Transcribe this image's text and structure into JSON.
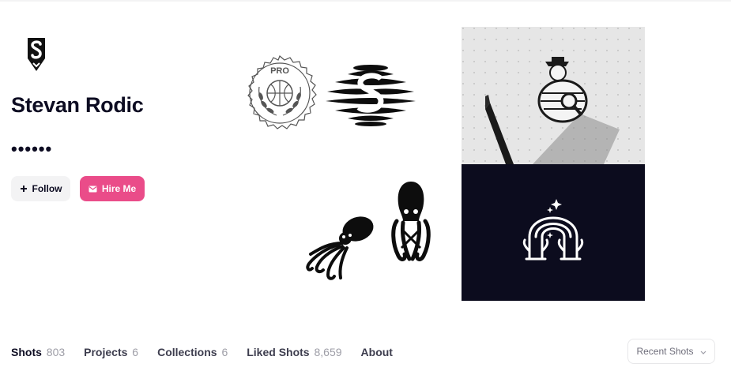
{
  "profile": {
    "name": "Stevan Rodic",
    "bio_dots": "••••••"
  },
  "actions": {
    "follow_label": "Follow",
    "hire_label": "Hire Me"
  },
  "shots": {
    "pro_badge_text": "PRO"
  },
  "tabs": [
    {
      "label": "Shots",
      "count": "803"
    },
    {
      "label": "Projects",
      "count": "6"
    },
    {
      "label": "Collections",
      "count": "6"
    },
    {
      "label": "Liked Shots",
      "count": "8,659"
    },
    {
      "label": "About",
      "count": ""
    }
  ],
  "sort": {
    "label": "Recent Shots"
  },
  "icons": {
    "avatar": "s-logo-icon",
    "follow": "plus-icon",
    "hire": "mail-icon",
    "sort": "chevron-down-icon"
  },
  "colors": {
    "brand_pink": "#ea4c89",
    "text_dark": "#0d0c22",
    "muted": "#9e9ea7",
    "dark_shot_bg": "#0c0c1e"
  }
}
